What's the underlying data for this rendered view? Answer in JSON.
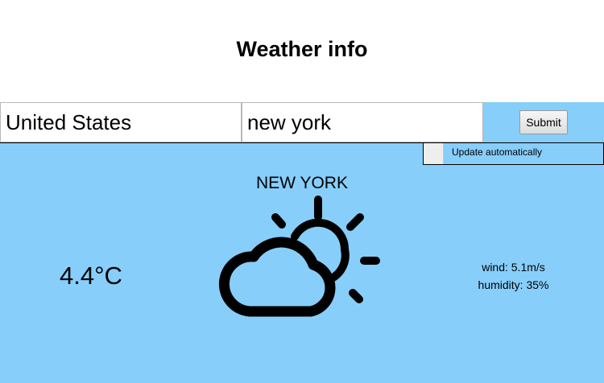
{
  "header": {
    "title": "Weather info"
  },
  "form": {
    "country_value": "United States",
    "city_value": "new york",
    "submit_label": "Submit"
  },
  "auto_update": {
    "label": "Update automatically",
    "checked": false
  },
  "weather": {
    "city": "NEW YORK",
    "temperature": "4.4°C",
    "wind": "wind: 5.1m/s",
    "humidity": "humidity: 35%",
    "icon": "partly-cloudy-icon"
  },
  "colors": {
    "panel_background": "#87cefa",
    "page_background": "#ffffff"
  }
}
